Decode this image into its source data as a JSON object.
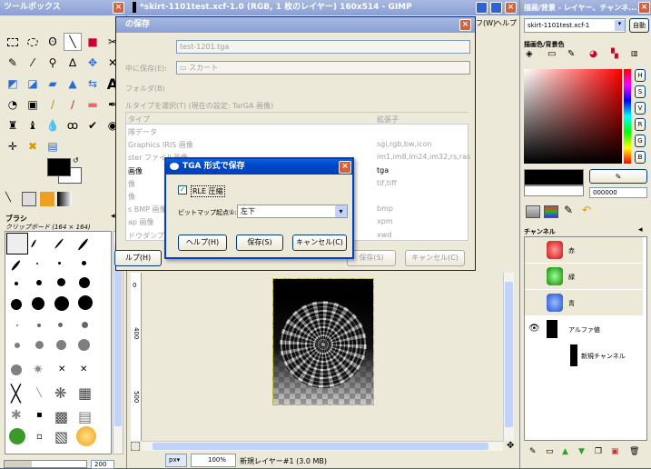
{
  "toolbox": {
    "title": "ツールボックス",
    "brush_title": "ブラシ",
    "brush_sub": "クリップボード (164 × 164)",
    "spacing_value": "200"
  },
  "image_window": {
    "title": "*skirt-1101test.xcf-1.0 (RGB, 1 枚のレイヤー) 160x514 - GIMP",
    "menu_partial": "フ(W)",
    "menu_help": "ヘルプ",
    "unit": "px",
    "zoom": "100%",
    "status": "新規レイヤー#1 (3.0 MB)",
    "ruler_marks": [
      "0",
      "400",
      "500"
    ]
  },
  "save_dialog": {
    "title": "の保存",
    "filename": "test-1201.tga",
    "folder_label": "中に保存(E):",
    "folder_value": "スカート",
    "browse_label": "フォルダ(B)",
    "filetype_label": "ルタイプを選択(T) (現在の設定: TarGA 画像)",
    "col_type": "タイプ",
    "col_ext": "拡張子",
    "rows": [
      {
        "name": "隊データ",
        "ext": ""
      },
      {
        "name": "Graphics IRIS 画像",
        "ext": "sgi,rgb,bw,icon"
      },
      {
        "name": "ster ファイル画像",
        "ext": "im1,im8,im24,im32,rs,ras"
      },
      {
        "name": "画像",
        "ext": "tga"
      },
      {
        "name": "像",
        "ext": "tif,tiff"
      },
      {
        "name": "像",
        "ext": ""
      },
      {
        "name": "s BMP 画像",
        "ext": "bmp"
      },
      {
        "name": "ap 画像",
        "ext": "xpm"
      },
      {
        "name": "ドウダンプ",
        "ext": "xwd"
      }
    ],
    "help_btn": "ルプ(H)",
    "save_btn": "保存(S)",
    "cancel_btn": "キャンセル(C)"
  },
  "tga_dialog": {
    "title": "TGA 形式で保存",
    "rle_label": "RLE 圧縮",
    "rle_checked": true,
    "origin_label": "ビットマップ起点①:",
    "origin_value": "左下",
    "help_btn": "ヘルプ(H)",
    "save_btn": "保存(S)",
    "cancel_btn": "キャンセル(C)"
  },
  "layers_window": {
    "title": "描画/背景 - レイヤー、チャンネ...",
    "image_select": "skirt-1101test.xcf-1",
    "auto_btn": "自動",
    "fgbg_title": "描画色/背景色",
    "hex_value": "000000",
    "channels_title": "チャンネル",
    "channels": [
      {
        "name": "赤",
        "color": "#d01818"
      },
      {
        "name": "緑",
        "color": "#20a020"
      },
      {
        "name": "青",
        "color": "#2060c8"
      },
      {
        "name": "アルファ値",
        "color": "#000000"
      },
      {
        "name": "新規チャンネル",
        "color": "#000000"
      }
    ],
    "side_labels": [
      "H",
      "S",
      "V",
      "R",
      "G",
      "B"
    ]
  }
}
